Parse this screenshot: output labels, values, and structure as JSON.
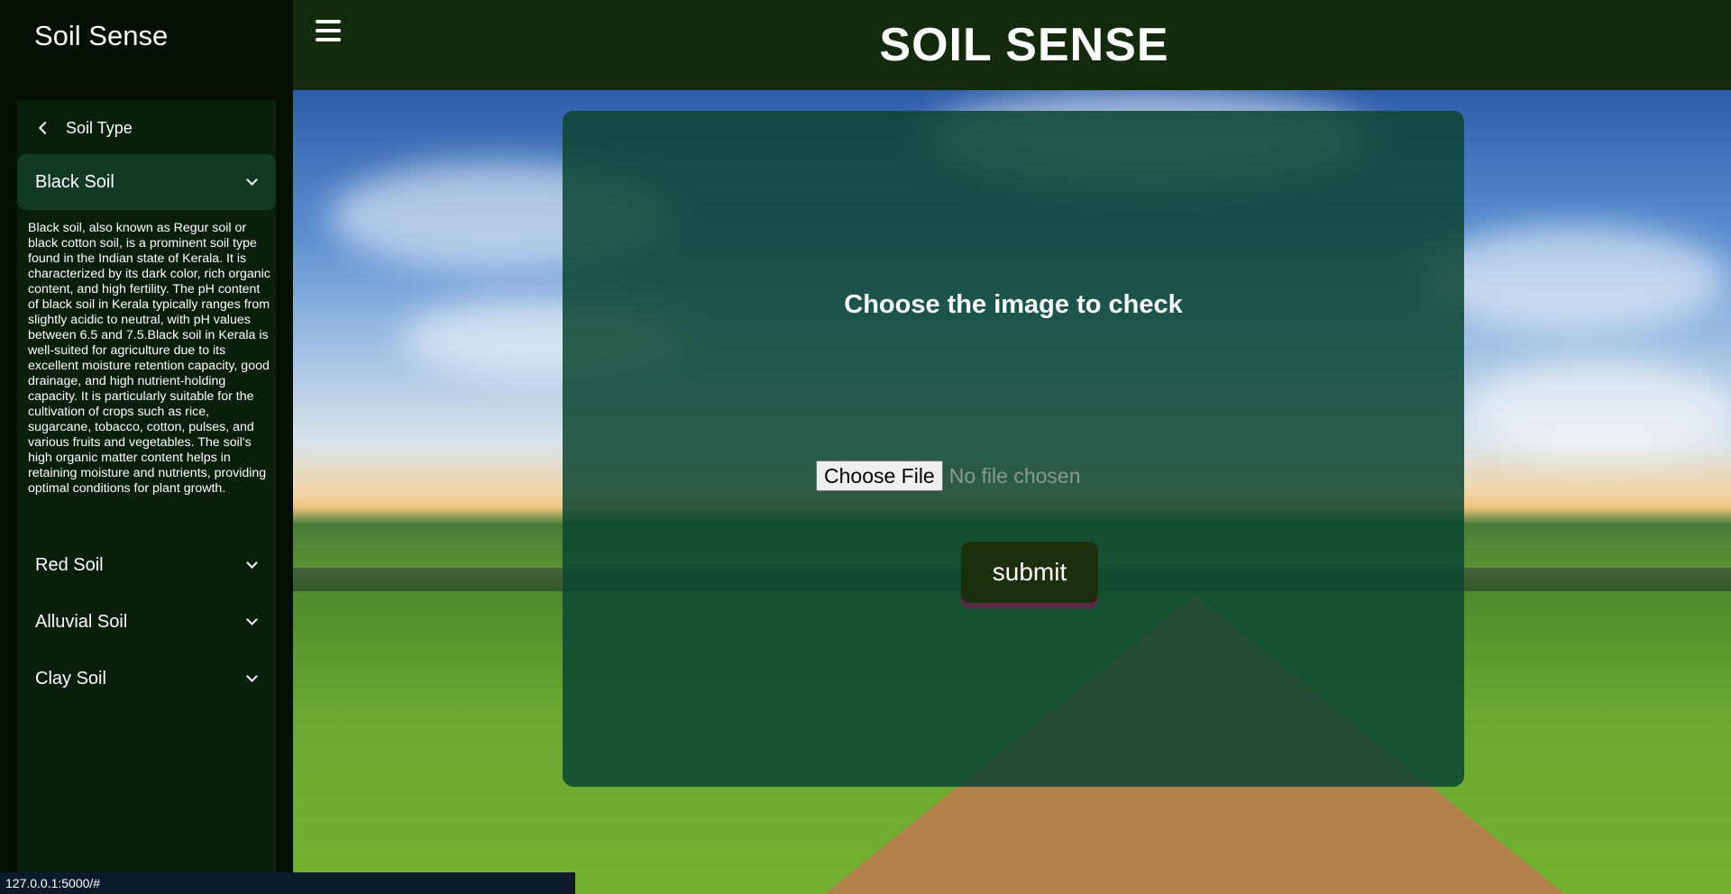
{
  "sidebar": {
    "brand": "Soil Sense",
    "back_label": "Soil Type",
    "items": [
      {
        "label": "Black Soil",
        "expanded": true,
        "description": "Black soil, also known as Regur soil or black cotton soil, is a prominent soil type found in the Indian state of Kerala. It is characterized by its dark color, rich organic content, and high fertility. The pH content of black soil in Kerala typically ranges from slightly acidic to neutral, with pH values between 6.5 and 7.5.Black soil in Kerala is well-suited for agriculture due to its excellent moisture retention capacity, good drainage, and high nutrient-holding capacity. It is particularly suitable for the cultivation of crops such as rice, sugarcane, tobacco, cotton, pulses, and various fruits and vegetables. The soil's high organic matter content helps in retaining moisture and nutrients, providing optimal conditions for plant growth."
      },
      {
        "label": "Red Soil",
        "expanded": false
      },
      {
        "label": "Alluvial Soil",
        "expanded": false
      },
      {
        "label": "Clay Soil",
        "expanded": false
      }
    ]
  },
  "header": {
    "title": "SOIL SENSE",
    "menu_icon": "hamburger-icon"
  },
  "card": {
    "heading": "Choose the image to check",
    "file_button_label": "Choose File",
    "file_status": "No file chosen",
    "submit_label": "submit"
  },
  "status_bar": {
    "url": "127.0.0.1:5000/#"
  },
  "colors": {
    "sidebar_bg": "#041004",
    "topbar_bg": "#142a0c",
    "card_bg": "#0c4632",
    "submit_bg": "#1d2e0c",
    "active_item_bg": "#113a22"
  }
}
